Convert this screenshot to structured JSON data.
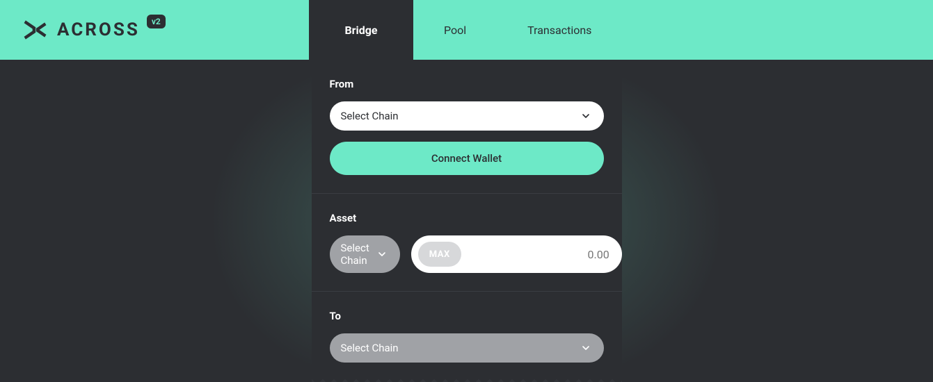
{
  "brand": {
    "name": "ACROSS",
    "badge": "v2"
  },
  "nav": {
    "items": [
      {
        "label": "Bridge",
        "active": true
      },
      {
        "label": "Pool",
        "active": false
      },
      {
        "label": "Transactions",
        "active": false
      }
    ]
  },
  "form": {
    "from": {
      "label": "From",
      "select_placeholder": "Select Chain",
      "connect_label": "Connect Wallet"
    },
    "asset": {
      "label": "Asset",
      "select_placeholder": "Select Chain",
      "max_label": "MAX",
      "amount_placeholder": "0.00"
    },
    "to": {
      "label": "To",
      "select_placeholder": "Select Chain"
    }
  }
}
